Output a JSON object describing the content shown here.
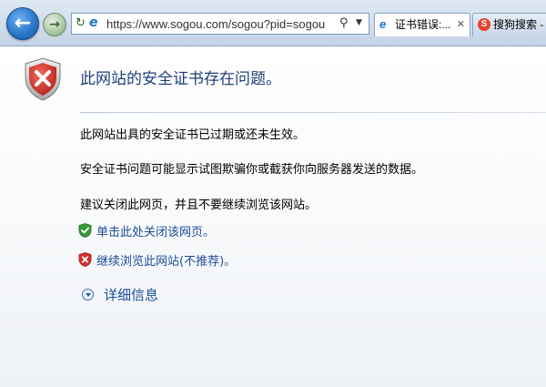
{
  "browser": {
    "address_url": "https://www.sogou.com/sogou?pid=sogou",
    "tabs": [
      {
        "label": "证书错误:...",
        "active": true,
        "icon": "ie-icon"
      },
      {
        "label": "搜狗搜索 -",
        "active": false,
        "icon": "sogou-icon"
      }
    ]
  },
  "page": {
    "heading": "此网站的安全证书存在问题。",
    "paragraphs": [
      "此网站出具的安全证书已过期或还未生效。",
      "安全证书问题可能显示试图欺骗你或截获你向服务器发送的数据。",
      "建议关闭此网页，并且不要继续浏览该网站。"
    ],
    "options": {
      "close_label": "单击此处关闭该网页。",
      "continue_label": "继续浏览此网站(不推荐)。"
    },
    "more_info_label": "详细信息"
  },
  "colors": {
    "heading": "#1f3f78",
    "link": "#1d4d9b",
    "error_red": "#d0312d",
    "safe_green": "#3a9a3a"
  }
}
